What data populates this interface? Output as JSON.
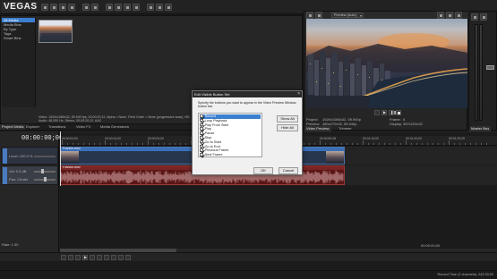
{
  "app": {
    "name": "VEGAS"
  },
  "project_media": {
    "tree": [
      {
        "label": "All Media",
        "selected": true
      },
      {
        "label": "Media Bins",
        "selected": false
      },
      {
        "label": "By Type",
        "selected": false
      },
      {
        "label": "Tags",
        "selected": false
      },
      {
        "label": "Smart Bins",
        "selected": false
      }
    ],
    "info_line1": "Video: 1920x1080x32, 59.940 fps, 00:00:20;12, Alpha = None, Field Order = None (progressive scan), HD",
    "info_line2": "Audio: 48,000 Hz, Stereo, 00:00:20;12, AAC"
  },
  "tabs_left": [
    "Project Media",
    "Explorer",
    "Transitions",
    "Video FX",
    "Media Generators"
  ],
  "preview": {
    "dropdown": "Preview (Auto)",
    "project_label": "Project:",
    "project_value": "1920x1080x32, 59.940p",
    "preview_label": "Preview:",
    "preview_value": "480x270x32, 59.940p",
    "frame_label": "Frame:",
    "frame_value": "0",
    "display_label": "Display:",
    "display_value": "397x223x32",
    "tabs": [
      "Video Preview",
      "Trimmer"
    ],
    "master_bus": "Master Bus"
  },
  "timeline": {
    "timecode": "00:00:00;00",
    "rate_label": "Rate: 1.00",
    "level_label": "Level: 100.0 %",
    "vol_label": "Vol: 0.0 dB",
    "pan_label": "Pan: Center",
    "clip_label_video": "Frankin.mov",
    "clip_label_audio": "Frankin.mov",
    "ruler_labels": [
      "00:00:00;00",
      "00:00:10;00",
      "00:00:20;00",
      "00:00:29;29",
      "00:00:39;29",
      "00:00:49;29",
      "00:00:59;28",
      "00:01:10;00",
      "00:01:20;00",
      "00:01:29;29"
    ],
    "bottom_timecode": "00:00:00;00",
    "record_time": "Record Time (2 channels): 242:33:20"
  },
  "dialog": {
    "title": "Edit Visible Button Set",
    "instructions": "Specify the buttons you want to appear in the Video Preview Window button bar.",
    "items": [
      {
        "label": "Record",
        "checked": true,
        "selected": true
      },
      {
        "label": "Loop Playback",
        "checked": true,
        "selected": false
      },
      {
        "label": "Play From Start",
        "checked": true,
        "selected": false
      },
      {
        "label": "Play",
        "checked": true,
        "selected": false
      },
      {
        "label": "Pause",
        "checked": true,
        "selected": false
      },
      {
        "label": "Stop",
        "checked": true,
        "selected": false
      },
      {
        "label": "Go to Start",
        "checked": true,
        "selected": false
      },
      {
        "label": "Go to End",
        "checked": true,
        "selected": false
      },
      {
        "label": "Previous Frame",
        "checked": true,
        "selected": false
      },
      {
        "label": "Next Frame",
        "checked": true,
        "selected": false
      }
    ],
    "show_all": "Show All",
    "hide_all": "Hide All",
    "ok": "OK",
    "cancel": "Cancel"
  },
  "colors": {
    "accent": "#3b7fd0",
    "clip_video": "#3a6fb8",
    "clip_audio": "#8a1f1f"
  }
}
